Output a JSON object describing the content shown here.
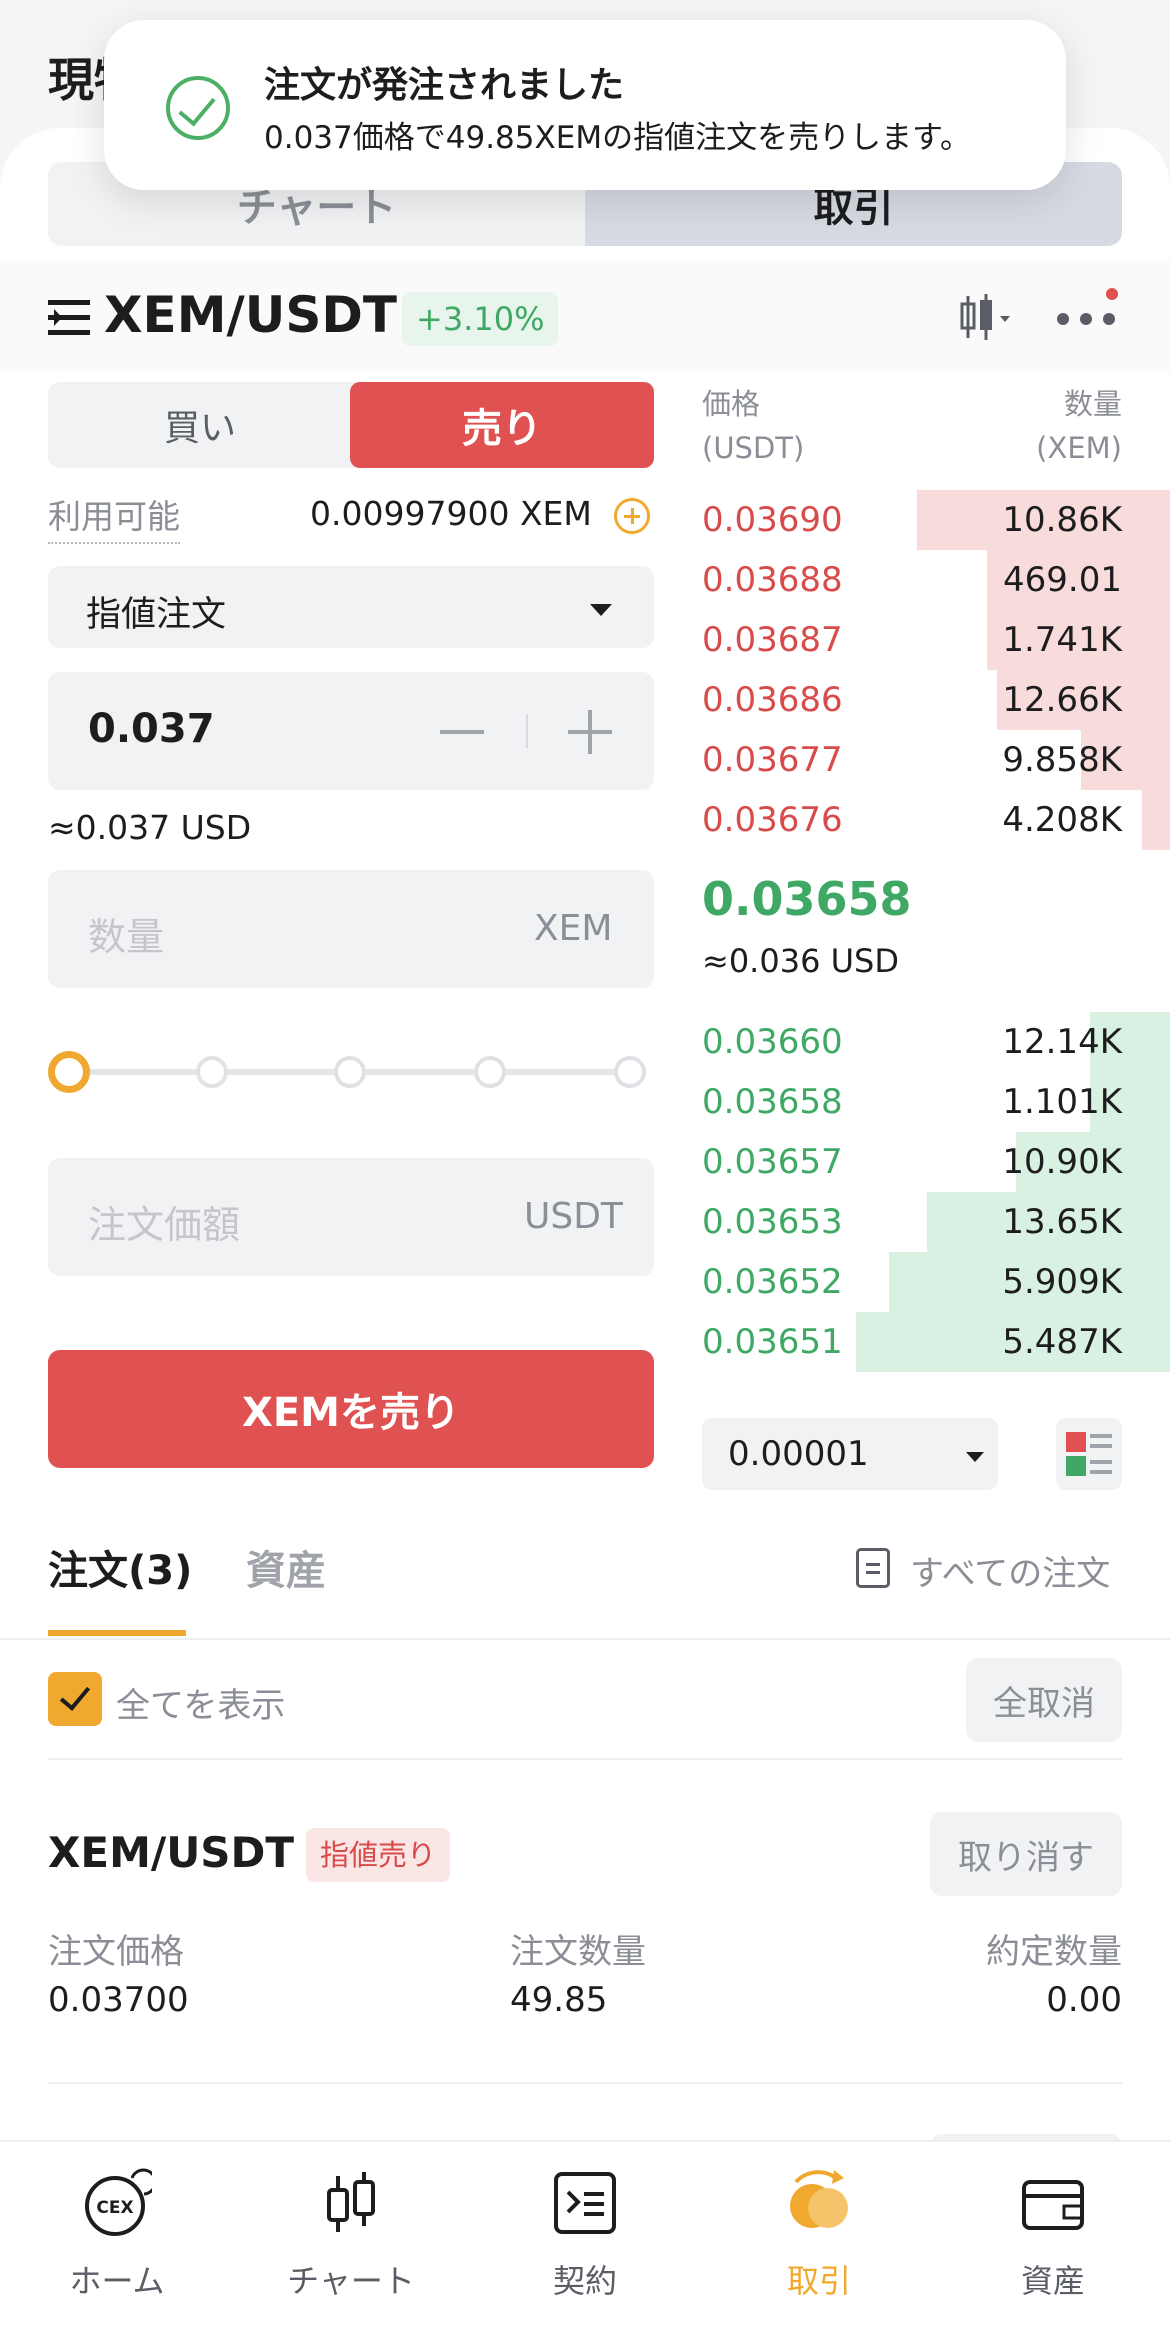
{
  "header": {
    "title_partial": "現物"
  },
  "view_tabs": [
    {
      "label": "チャート"
    },
    {
      "label": "取引"
    }
  ],
  "toast": {
    "title": "注文が発注されました",
    "message": "0.037価格で49.85XEMの指値注文を売りします。",
    "status_color": "#4caf63"
  },
  "pair": {
    "symbol": "XEM/USDT",
    "change": "+3.10%"
  },
  "trade_form": {
    "buy_label": "買い",
    "sell_label": "売り",
    "available_label": "利用可能",
    "available_value": "0.00997900 XEM",
    "order_type": "指値注文",
    "price_value": "0.037",
    "price_usd": "≈0.037 USD",
    "quantity_placeholder": "数量",
    "quantity_unit": "XEM",
    "slider_percent": 0,
    "total_placeholder": "注文価額",
    "total_unit": "USDT",
    "submit_label": "XEMを売り"
  },
  "order_book": {
    "price_header": "価格",
    "price_unit": "(USDT)",
    "qty_header": "数量",
    "qty_unit": "(XEM)",
    "asks": [
      {
        "price": "0.03690",
        "qty": "10.86K",
        "depth": 0.54
      },
      {
        "price": "0.03688",
        "qty": "469.01",
        "depth": 0.39
      },
      {
        "price": "0.03687",
        "qty": "1.741K",
        "depth": 0.39
      },
      {
        "price": "0.03686",
        "qty": "12.66K",
        "depth": 0.37
      },
      {
        "price": "0.03677",
        "qty": "9.858K",
        "depth": 0.19
      },
      {
        "price": "0.03676",
        "qty": "4.208K",
        "depth": 0.06
      }
    ],
    "mid_price": "0.03658",
    "mid_usd": "≈0.036 USD",
    "bids": [
      {
        "price": "0.03660",
        "qty": "12.14K",
        "depth": 0.17
      },
      {
        "price": "0.03658",
        "qty": "1.101K",
        "depth": 0.17
      },
      {
        "price": "0.03657",
        "qty": "10.90K",
        "depth": 0.33
      },
      {
        "price": "0.03653",
        "qty": "13.65K",
        "depth": 0.52
      },
      {
        "price": "0.03652",
        "qty": "5.909K",
        "depth": 0.6
      },
      {
        "price": "0.03651",
        "qty": "5.487K",
        "depth": 0.67
      }
    ],
    "precision": "0.00001"
  },
  "orders": {
    "tab_orders": "注文(3)",
    "tab_assets": "資産",
    "all_orders_link": "すべての注文",
    "show_all_label": "全てを表示",
    "cancel_all_label": "全取消",
    "items": [
      {
        "pair": "XEM/USDT",
        "badge": "指値売り",
        "cancel_label": "取り消す",
        "price_label": "注文価格",
        "price": "0.03700",
        "qty_label": "注文数量",
        "qty": "49.85",
        "filled_label": "約定数量",
        "filled": "0.00"
      }
    ]
  },
  "bottom_nav": [
    {
      "label": "ホーム",
      "icon": "cex-home-icon"
    },
    {
      "label": "チャート",
      "icon": "candlestick-icon"
    },
    {
      "label": "契約",
      "icon": "contract-icon"
    },
    {
      "label": "取引",
      "icon": "trade-icon",
      "active": true
    },
    {
      "label": "資産",
      "icon": "wallet-icon"
    }
  ],
  "colors": {
    "accent": "#f0a92e",
    "sell": "#e05252",
    "buy": "#3fa864"
  }
}
